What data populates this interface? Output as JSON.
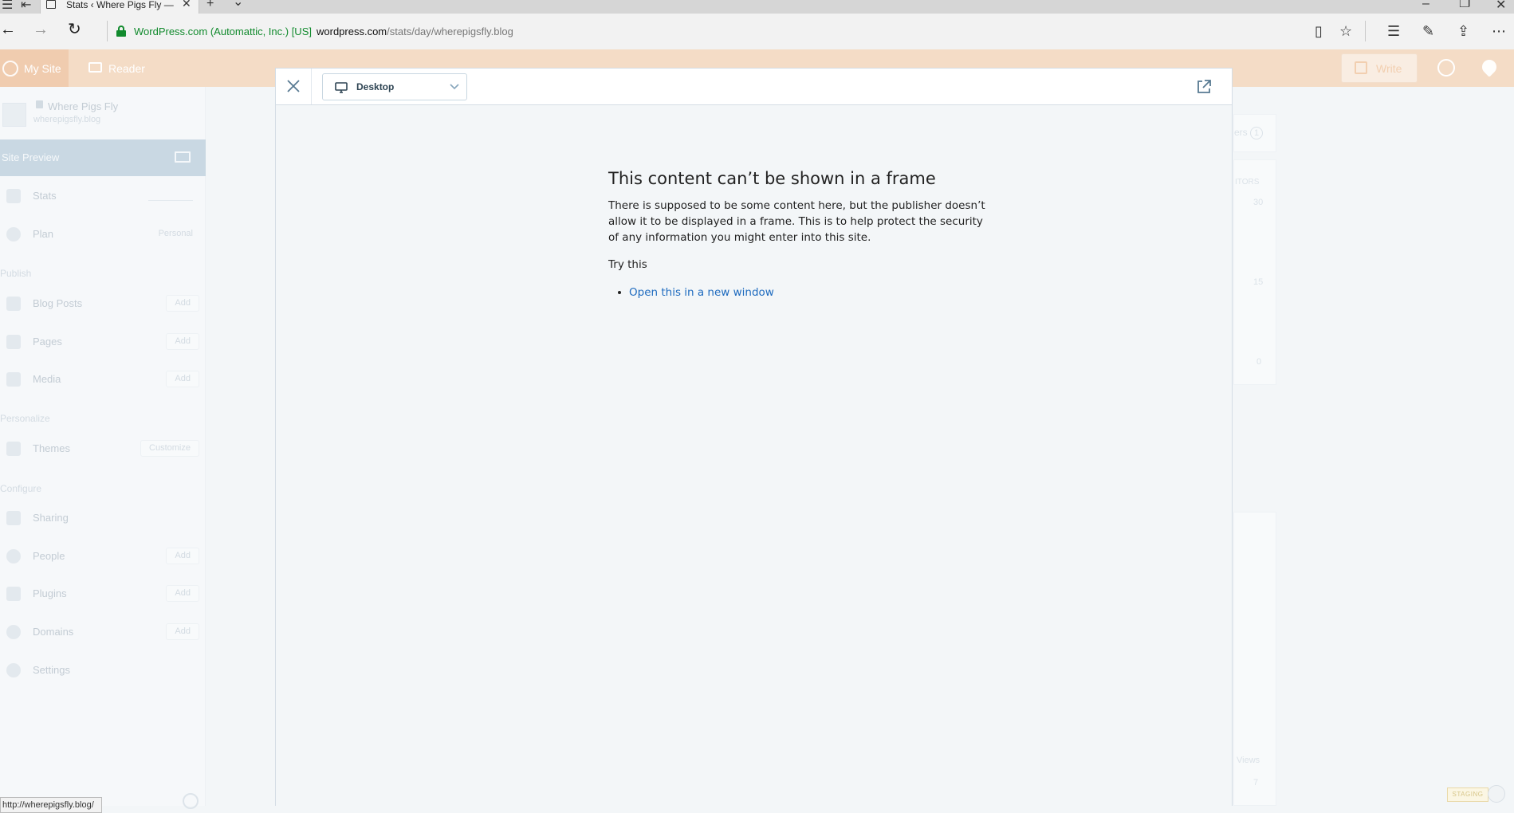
{
  "browser": {
    "tab_title": "Stats ‹ Where Pigs Fly —",
    "tab_close": "✕",
    "new_tab": "+",
    "tab_menu": "⌄",
    "cert_label": "WordPress.com (Automattic, Inc.) [US]",
    "url_host": "wordpress.com",
    "url_path": "/stats/day/wherepigsfly.blog",
    "status_url": "http://wherepigsfly.blog/"
  },
  "masterbar": {
    "my_site": "My Site",
    "reader": "Reader",
    "write": "Write"
  },
  "sidebar": {
    "site_name": "Where Pigs Fly",
    "site_domain": "wherepigsfly.blog",
    "site_preview": "Site Preview",
    "stats": "Stats",
    "plan": "Plan",
    "plan_value": "Personal",
    "section_publish": "Publish",
    "blog_posts": "Blog Posts",
    "pages": "Pages",
    "media": "Media",
    "section_personalize": "Personalize",
    "themes": "Themes",
    "customize": "Customize",
    "section_configure": "Configure",
    "sharing": "Sharing",
    "people": "People",
    "plugins": "Plugins",
    "domains": "Domains",
    "settings": "Settings",
    "add": "Add"
  },
  "background": {
    "followers_fragment": "ers",
    "followers_count": "1",
    "visitors_fragment": "ITORS",
    "axis_30": "30",
    "axis_15": "15",
    "axis_0": "0",
    "views_fragment": "Views",
    "views_value": "7",
    "staging": "STAGING"
  },
  "modal": {
    "device_label": "Desktop"
  },
  "frame_error": {
    "title": "This content can’t be shown in a frame",
    "body": "There is supposed to be some content here, but the publisher doesn’t allow it to be displayed in a frame. This is to help protect the security of any information you might enter into this site.",
    "try_this": "Try this",
    "link": "Open this in a new window"
  }
}
